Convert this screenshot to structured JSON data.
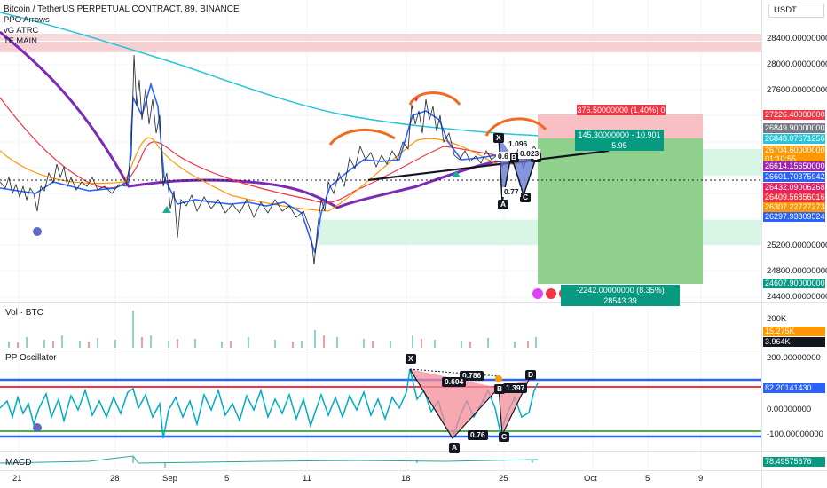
{
  "header": {
    "symbol_title": "Bitcoin / TetherUS PERPETUAL CONTRACT, 89, BINANCE",
    "indicators": [
      "PPO Arrows",
      "vG ATRC",
      "TF MAIN"
    ],
    "currency": "USDT"
  },
  "price_axis": [
    "28400.00000000",
    "28000.00000000",
    "27600.00000000",
    "25200.00000000",
    "24800.00000000",
    "24400.00000000"
  ],
  "price_tags": [
    {
      "text": "27226.40000000",
      "color": "#f23645"
    },
    {
      "text": "26849.90000000",
      "color": "#787b86"
    },
    {
      "text": "26848.07671256",
      "color": "#26c6da"
    },
    {
      "text": "26704.60000000",
      "color": "#ff9800"
    },
    {
      "text": "01:10:55",
      "color": "#ff9800"
    },
    {
      "text": "26614.15650000",
      "color": "#9c27b0"
    },
    {
      "text": "26601.70375942",
      "color": "#2962ff"
    },
    {
      "text": "26432.09006268",
      "color": "#e91e63"
    },
    {
      "text": "26409.56856016",
      "color": "#f23645"
    },
    {
      "text": "26307.22727273",
      "color": "#ff9800"
    },
    {
      "text": "26297.93809524",
      "color": "#2962ff"
    },
    {
      "text": "24607.90000000",
      "color": "#089981"
    }
  ],
  "position": {
    "target_label": "376.50000000 (1.40%) 0",
    "entry_label_line1": "145.30000000 - 10.901",
    "entry_label_line2": "5.95",
    "stop_label": "-2242.00000000 (8.35%) 28543.39"
  },
  "harmonic_main": {
    "labels": [
      "X",
      "A",
      "B",
      "C",
      "D"
    ],
    "ratios": [
      "1.096",
      "0.6",
      "0.023",
      "0.77"
    ]
  },
  "volume_pane": {
    "title": "Vol · BTC",
    "axis": [
      "200K"
    ],
    "tags": [
      {
        "text": "15.275K",
        "color": "#ff9800"
      },
      {
        "text": "3.964K",
        "color": "#131722"
      }
    ]
  },
  "oscillator_pane": {
    "title": "PP Oscillator",
    "axis": [
      "200.00000000",
      "0.00000000",
      "-100.00000000"
    ],
    "tag": {
      "text": "82.20141430",
      "color": "#2962ff"
    },
    "labels": [
      "X",
      "A",
      "B",
      "C",
      "D"
    ],
    "ratios": [
      "0.786",
      "0.604",
      "1.397",
      "0.76"
    ]
  },
  "macd_pane": {
    "title": "MACD",
    "tag": {
      "text": "78.49575676",
      "color": "#089981"
    }
  },
  "time_axis": [
    "21",
    "28",
    "Sep",
    "5",
    "11",
    "18",
    "25",
    "Oct",
    "5",
    "9"
  ]
}
